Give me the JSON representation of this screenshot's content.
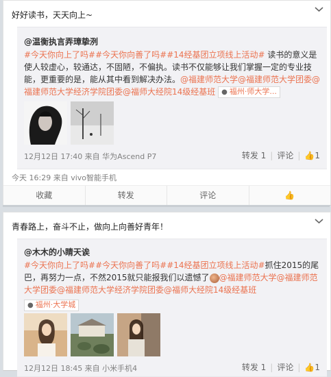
{
  "post1": {
    "text": "好好读书，天天向上~",
    "quote": {
      "author": "@温衡执言弄璋挚洌",
      "text_segments": [
        {
          "t": "#今天你向上了吗##今天你向善了吗##14经基团立项线上活动#",
          "hl": true
        },
        {
          "t": " 读书的意义是使人较虚心，较通达，不固陋，不偏执。读书不仅能够让我们掌握一定的专业技能，更重要的是，能从其中看到解决办法。",
          "hl": false
        },
        {
          "t": "@福建师范大学@福建师范大学团委@福建师范大学经济学院团委@福师大经院14级经基班",
          "hl": true
        }
      ],
      "location": "福州·师大学...",
      "meta": "12月12日 17:40 来自 华为Ascend P7",
      "repost": "转发 1",
      "comment": "评论",
      "like": "1"
    },
    "meta": "今天 16:29 来自 vivo智能手机",
    "actions": [
      "收藏",
      "转发",
      "评论"
    ]
  },
  "post2": {
    "text": "青春路上，奋斗不止，做向上向善好青年！",
    "quote": {
      "author": "@木木的小睛天诶",
      "text_a": "#今天你向上了吗##今天你向善了吗##14经基团立项线上活动#",
      "text_b": "抓住2015的尾巴，再努力一点，不然2015就只能报我们以遗憾了",
      "text_c": "@福建师范大学@福建师范大学团委@福建师范大学经济学院团委@福师大经院14级经基班",
      "location": "福州·大学城",
      "meta": "12月12日 18:45 来自 小米手机4",
      "repost": "转发 1",
      "comment": "评论",
      "like": "1"
    }
  },
  "icons": {
    "dropdown": "chevron-down-icon",
    "pin": "location-pin-icon",
    "thumb": "thumbs-up-icon"
  }
}
